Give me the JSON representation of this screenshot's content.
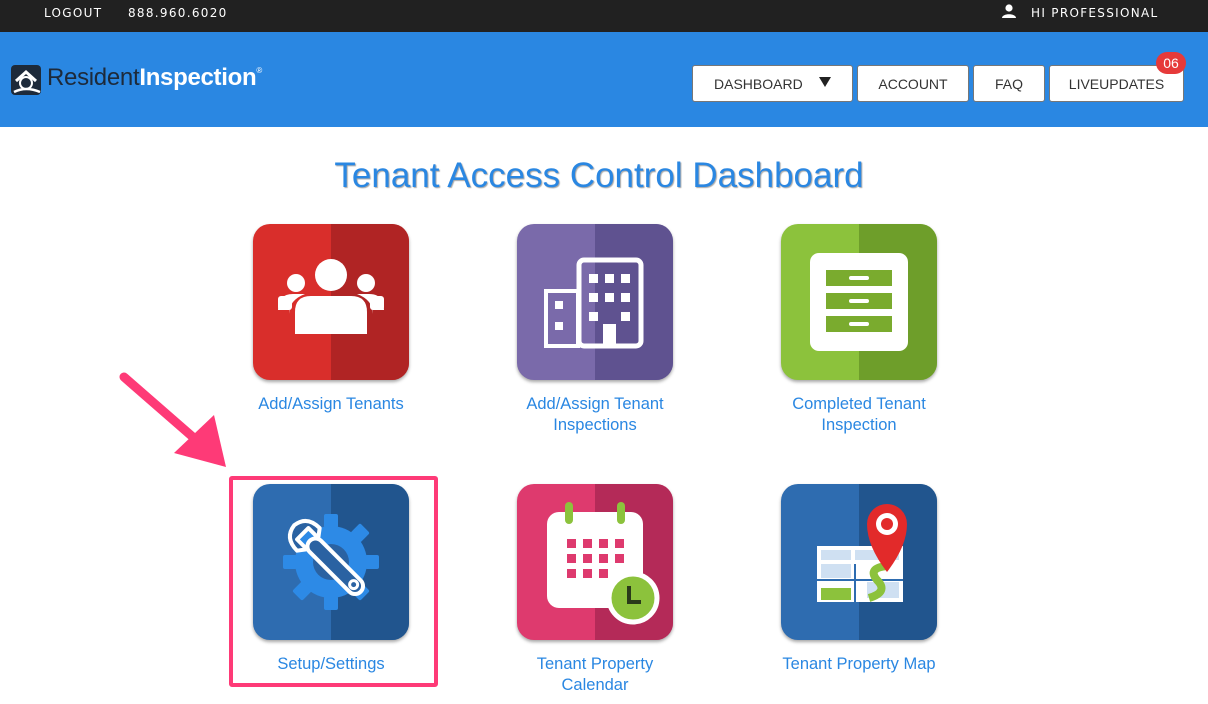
{
  "topbar": {
    "logout": "LOGOUT",
    "phone": "888.960.6020",
    "greeting": "HI PROFESSIONAL",
    "user_icon": "user-icon"
  },
  "header": {
    "logo": {
      "part1": "Resident",
      "part2": "Inspection",
      "mark": "®"
    },
    "nav": {
      "dashboard": "DASHBOARD",
      "account": "ACCOUNT",
      "faq": "FAQ",
      "liveupdates": "LIVEUPDATES",
      "liveupdates_badge": "06"
    }
  },
  "page": {
    "title": "Tenant Access Control Dashboard"
  },
  "tiles": [
    {
      "label": "Add/Assign Tenants",
      "icon": "people-group-icon",
      "color": "#d92e2b"
    },
    {
      "label_line1": "Add/Assign Tenant",
      "label_line2": "Inspections",
      "icon": "building-icon",
      "color": "#7a6aaa"
    },
    {
      "label_line1": "Completed Tenant",
      "label_line2": "Inspection",
      "icon": "file-cabinet-icon",
      "color": "#8cc23c"
    },
    {
      "label": "Setup/Settings",
      "icon": "wrench-gear-icon",
      "color": "#2e6cb0"
    },
    {
      "label_line1": "Tenant Property",
      "label_line2": "Calendar",
      "icon": "calendar-clock-icon",
      "color": "#de3a6e"
    },
    {
      "label": "Tenant Property Map",
      "icon": "map-pin-icon",
      "color": "#2e6cb0"
    }
  ],
  "colors": {
    "header": "#2a87e2",
    "topbar": "#212121",
    "accent": "#fe3a77",
    "badge": "#e63a3a"
  }
}
